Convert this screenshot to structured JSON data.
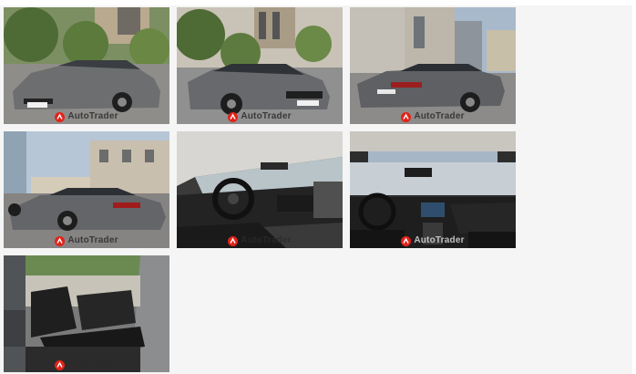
{
  "gallery": {
    "watermark_text": "AutoTrader",
    "brand_color": "#e2231a",
    "photos": [
      {
        "subject": "front-three-quarter exterior, trees background",
        "watermark_tone": "dark"
      },
      {
        "subject": "front view exterior, building background",
        "watermark_tone": "dark"
      },
      {
        "subject": "rear three-quarter exterior, buildings",
        "watermark_tone": "dark"
      },
      {
        "subject": "rear side exterior, buildings",
        "watermark_tone": "dark"
      },
      {
        "subject": "dashboard interior from driver door",
        "watermark_tone": "dark"
      },
      {
        "subject": "dashboard interior from rear seat, sunroof",
        "watermark_tone": "light"
      },
      {
        "subject": "rear seats interior",
        "watermark_tone": "dark"
      }
    ]
  }
}
